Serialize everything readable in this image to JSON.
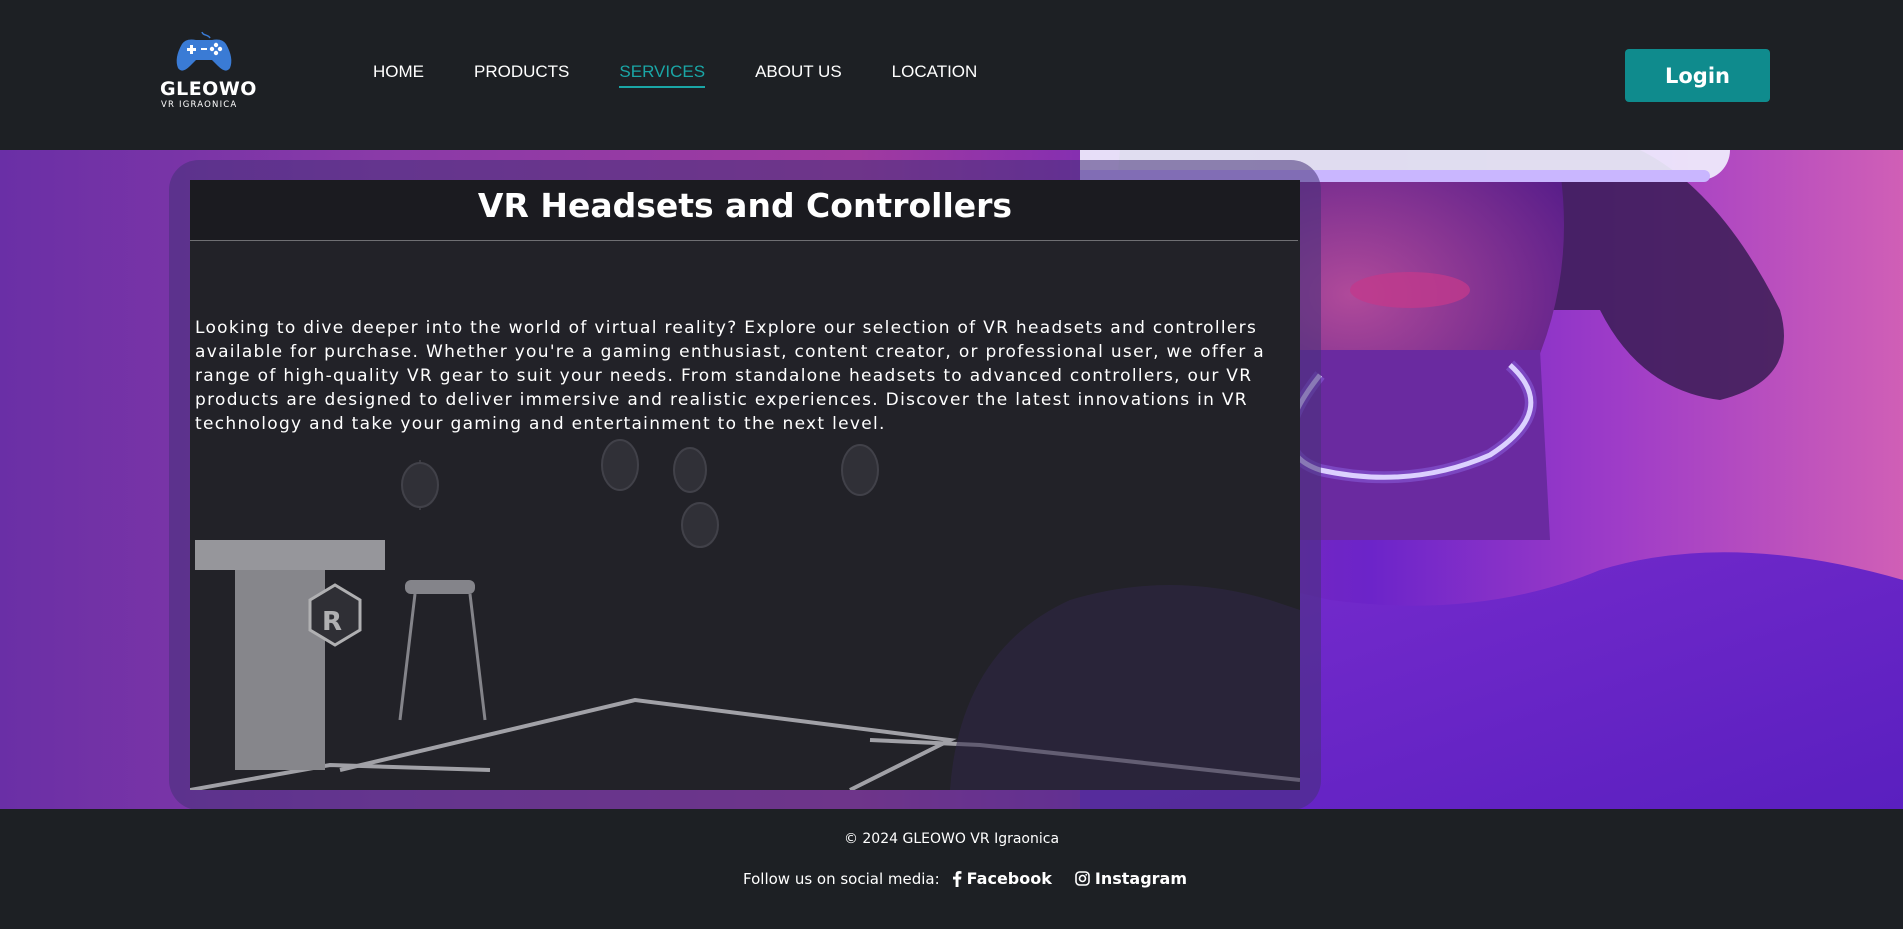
{
  "header": {
    "logo": {
      "name": "GLEOWO",
      "subtitle": "VR IGRAONICA",
      "icon": "gamepad-icon"
    },
    "nav": [
      {
        "label": "HOME",
        "active": false
      },
      {
        "label": "PRODUCTS",
        "active": false
      },
      {
        "label": "SERVICES",
        "active": true
      },
      {
        "label": "ABOUT US",
        "active": false
      },
      {
        "label": "LOCATION",
        "active": false
      }
    ],
    "login_label": "Login"
  },
  "hero": {
    "title": "VR Headsets and Controllers",
    "body": "Looking to dive deeper into the world of virtual reality? Explore our selection of VR headsets and controllers available for purchase. Whether you're a gaming enthusiast, content creator, or professional user, we offer a range of high-quality VR gear to suit your needs. From standalone headsets to advanced controllers, our VR products are designed to deliver immersive and realistic experiences. Discover the latest innovations in VR technology and take your gaming and entertainment to the next level."
  },
  "footer": {
    "copyright": "© 2024 GLEOWO VR Igraonica",
    "social_label": "Follow us on social media:",
    "facebook": "Facebook",
    "instagram": "Instagram"
  },
  "colors": {
    "background": "#1d2024",
    "accent": "#0f8b8d",
    "nav_active": "#1aa6a6",
    "hero_purple": "#6c24c9",
    "hero_pink": "#d05fb6"
  }
}
